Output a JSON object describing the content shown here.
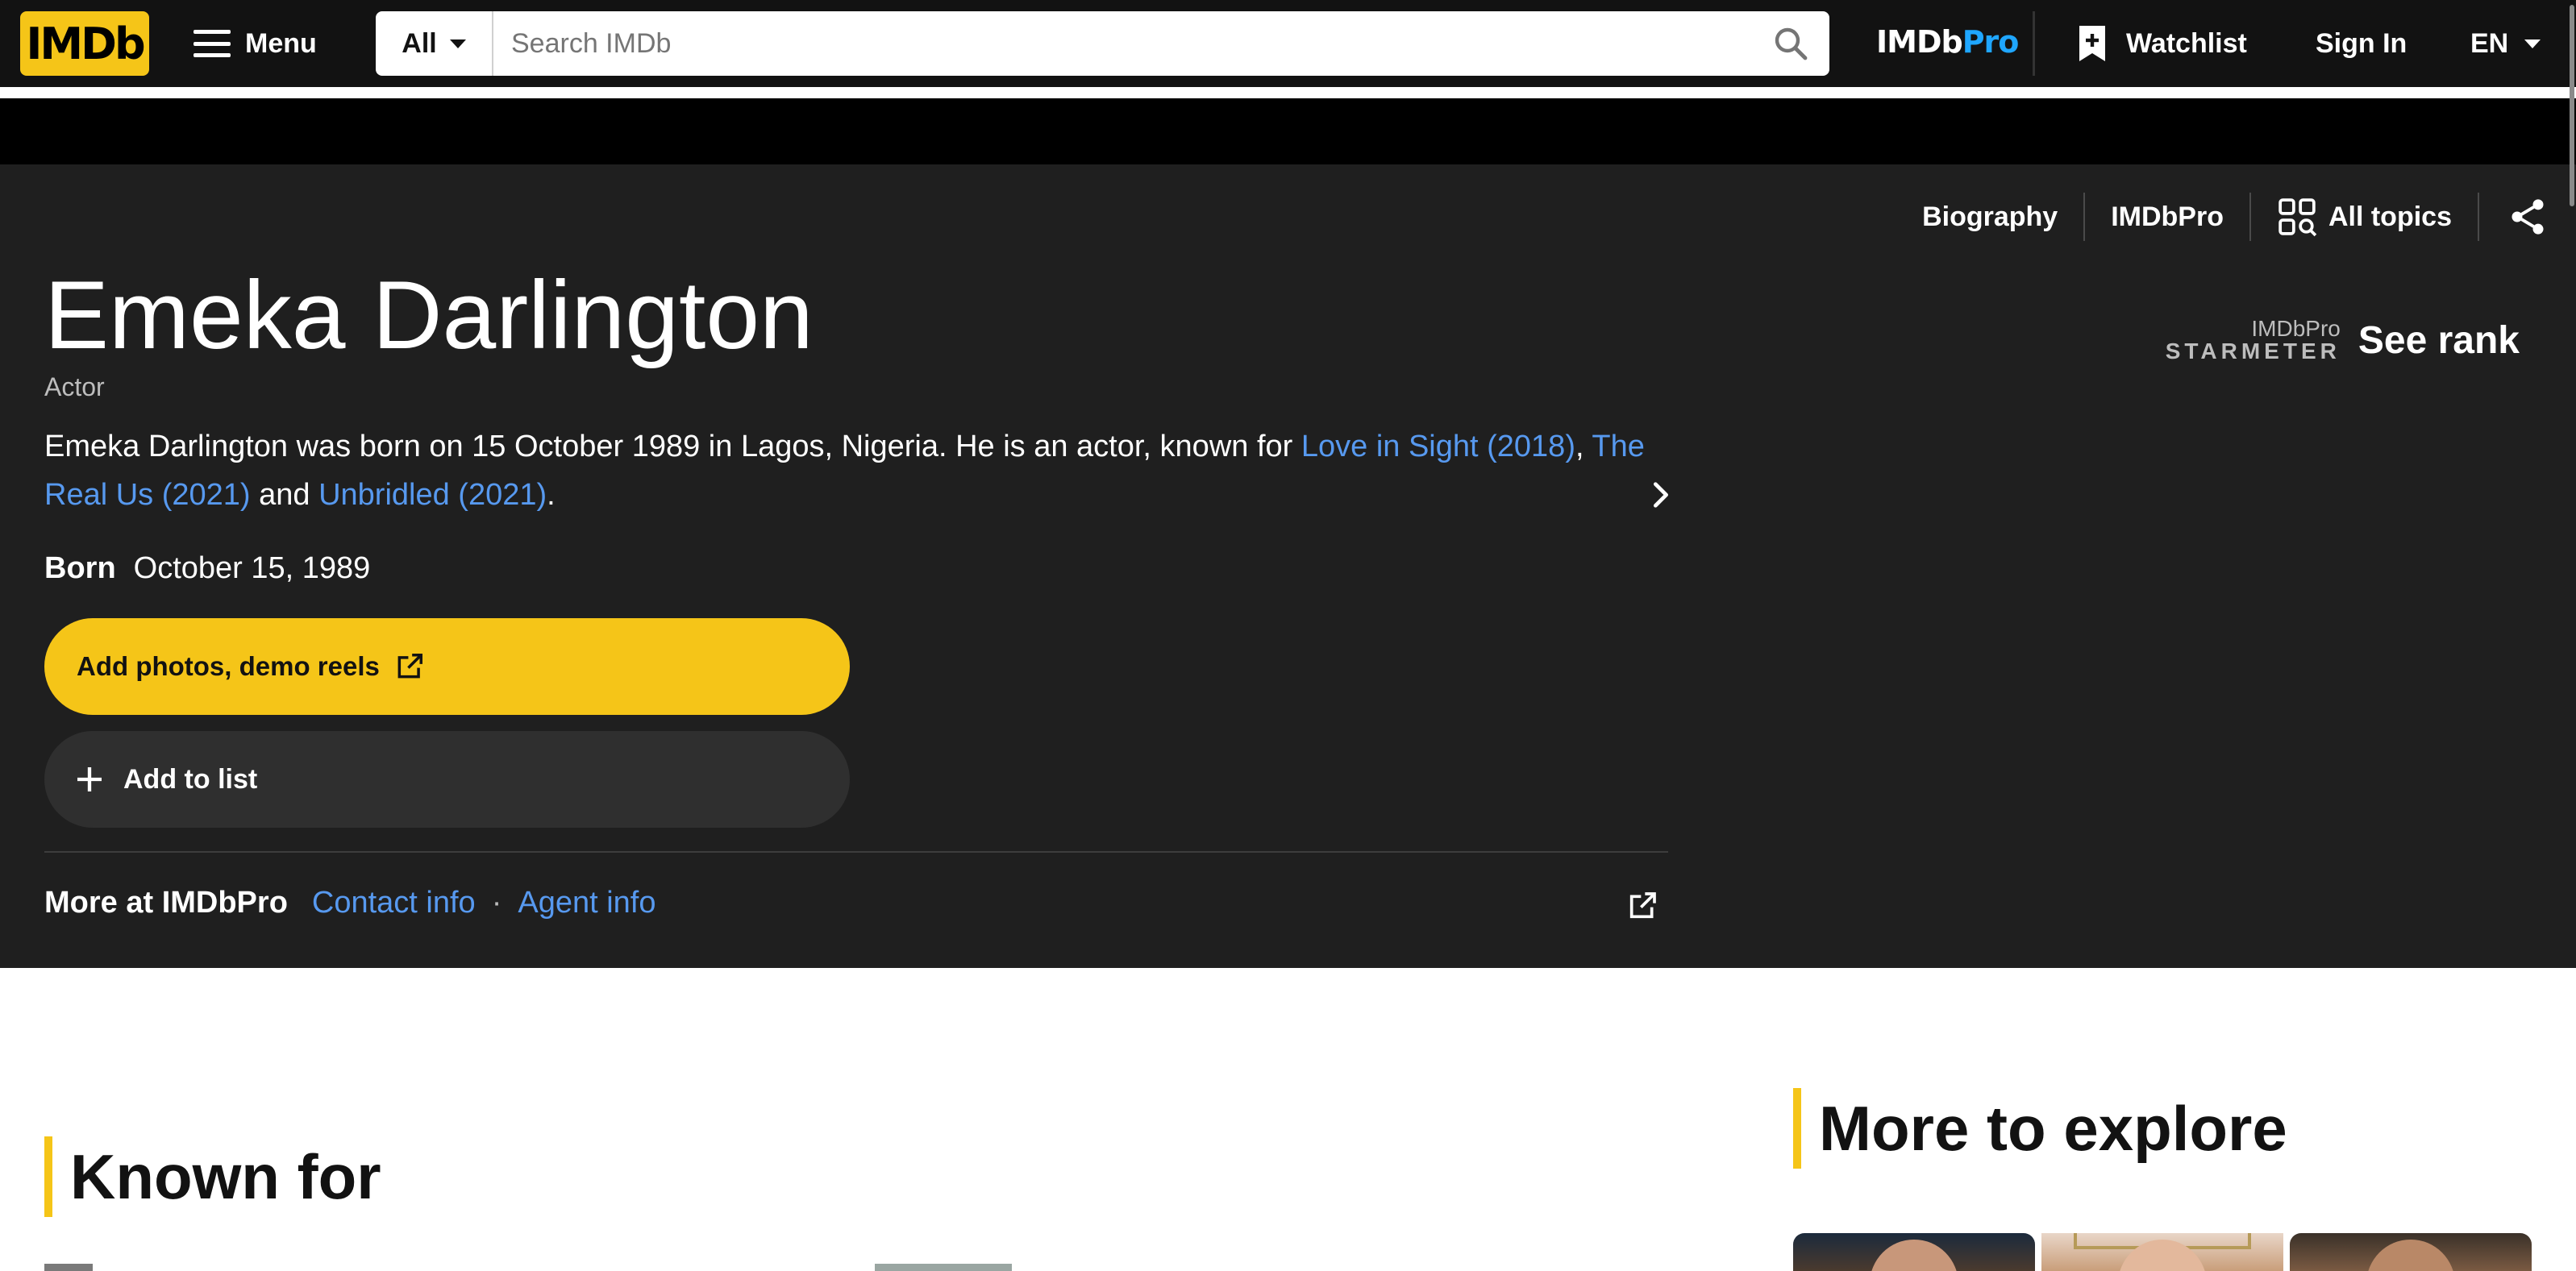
{
  "navbar": {
    "logo": "IMDb",
    "menu_label": "Menu",
    "search_category": "All",
    "search_placeholder": "Search IMDb",
    "imdbpro_logo_main": "IMDb",
    "imdbpro_logo_pro": "Pro",
    "watchlist_label": "Watchlist",
    "signin_label": "Sign In",
    "language": "EN"
  },
  "subnav": {
    "items": [
      "Biography",
      "IMDbPro",
      "All topics"
    ]
  },
  "person": {
    "name": "Emeka Darlington",
    "role": "Actor",
    "bio_prefix": "Emeka Darlington was born on 15 October 1989 in Lagos, Nigeria. He is an actor, known for ",
    "bio_link_1": "Love in Sight (2018)",
    "bio_sep_1": ", ",
    "bio_link_2": "The Real Us (2021)",
    "bio_sep_2": " and ",
    "bio_link_3": "Unbridled (2021)",
    "bio_suffix": ".",
    "born_label": "Born",
    "born_value": "October 15, 1989"
  },
  "actions": {
    "add_photos_label": "Add photos, demo reels",
    "add_to_list_label": "Add to list"
  },
  "imdbpro_more": {
    "label": "More at IMDbPro",
    "contact": "Contact info",
    "separator": "·",
    "agent": "Agent info"
  },
  "starmeter": {
    "pro_label": "IMDbPro",
    "meter_label": "STARMETER",
    "cta": "See rank"
  },
  "sections": {
    "known_for": "Known for",
    "more_to_explore": "More to explore"
  },
  "colors": {
    "accent": "#f5c518",
    "link": "#5799ef",
    "hero_bg": "#1f1f1f",
    "nav_bg": "#121212",
    "pro_blue": "#1fa6ff"
  },
  "icons": [
    "menu-icon",
    "caret-down-icon",
    "search-icon",
    "watchlist-add-icon",
    "all-topics-icon",
    "share-icon",
    "chevron-right-icon",
    "external-link-icon",
    "plus-icon"
  ]
}
